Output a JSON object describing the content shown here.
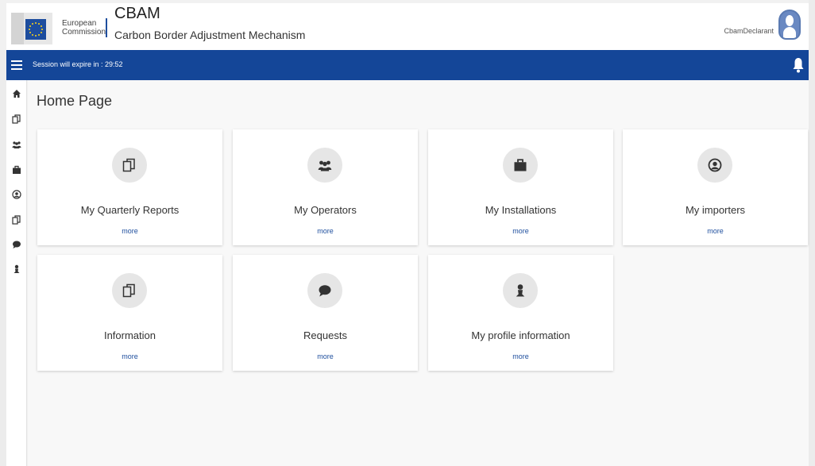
{
  "header": {
    "org_line1": "European",
    "org_line2": "Commission",
    "app_title": "CBAM",
    "app_subtitle": "Carbon Border Adjustment Mechanism",
    "user_name": "CbamDeclarant"
  },
  "session": {
    "text": "Session will expire in : 29:52"
  },
  "sidebar": {
    "items": [
      {
        "icon": "home-icon"
      },
      {
        "icon": "reports-icon"
      },
      {
        "icon": "operators-icon"
      },
      {
        "icon": "briefcase-icon"
      },
      {
        "icon": "account-icon"
      },
      {
        "icon": "information-icon"
      },
      {
        "icon": "chat-icon"
      },
      {
        "icon": "user-icon"
      }
    ]
  },
  "main": {
    "page_title": "Home Page",
    "cards": [
      {
        "label": "My Quarterly Reports",
        "more": "more",
        "icon": "reports-icon"
      },
      {
        "label": "My Operators",
        "more": "more",
        "icon": "operators-icon"
      },
      {
        "label": "My Installations",
        "more": "more",
        "icon": "briefcase-icon"
      },
      {
        "label": "My importers",
        "more": "more",
        "icon": "account-icon"
      },
      {
        "label": "Information",
        "more": "more",
        "icon": "information-icon"
      },
      {
        "label": "Requests",
        "more": "more",
        "icon": "chat-icon"
      },
      {
        "label": "My profile information",
        "more": "more",
        "icon": "user-icon"
      }
    ]
  },
  "colors": {
    "brand_blue": "#144698",
    "link_blue": "#1e4e9d",
    "card_bg": "#ffffff",
    "icon_circle": "#e6e6e6"
  }
}
